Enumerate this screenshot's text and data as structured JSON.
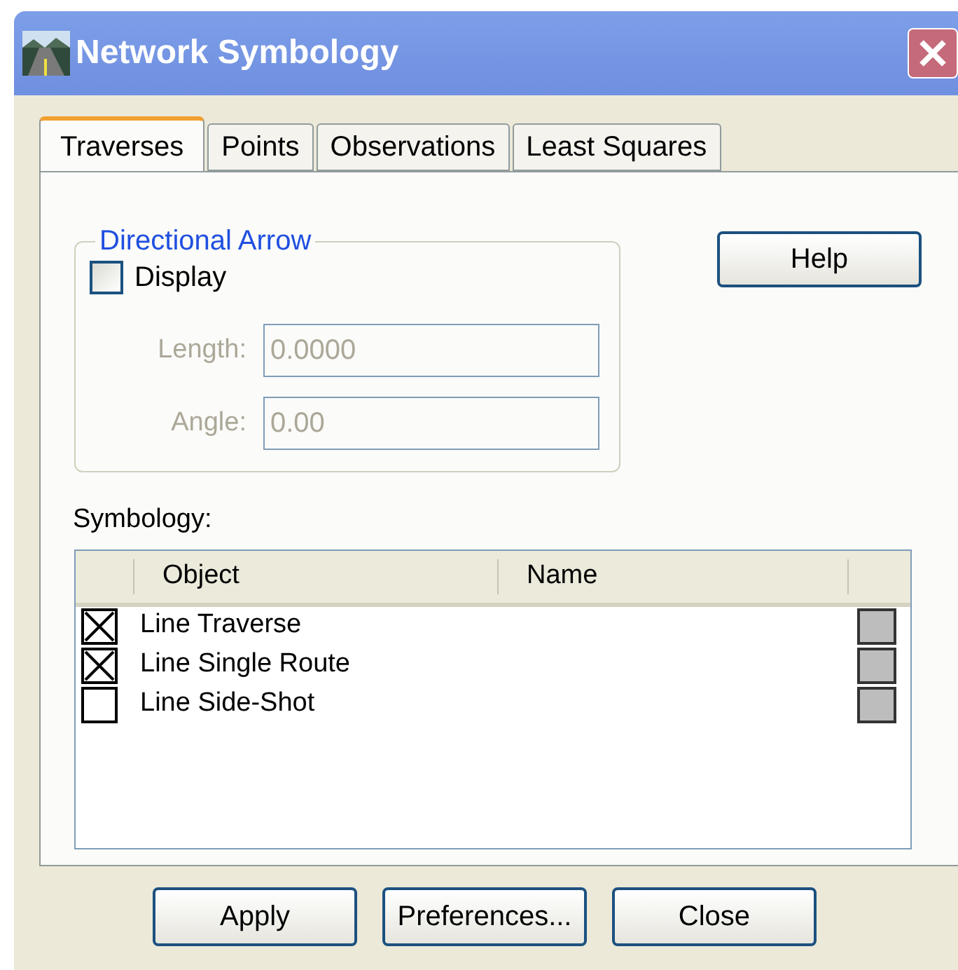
{
  "window": {
    "title": "Network Symbology"
  },
  "tabs": [
    {
      "label": "Traverses",
      "selected": true
    },
    {
      "label": "Points",
      "selected": false
    },
    {
      "label": "Observations",
      "selected": false
    },
    {
      "label": "Least Squares",
      "selected": false
    }
  ],
  "directional_arrow": {
    "legend": "Directional Arrow",
    "display": {
      "label": "Display",
      "checked": false
    },
    "fields": [
      {
        "label": "Length:",
        "value": "0.0000",
        "disabled": true
      },
      {
        "label": "Angle:",
        "value": "0.00",
        "disabled": true
      }
    ]
  },
  "help_button": "Help",
  "symbology": {
    "label": "Symbology:",
    "columns": [
      "Object",
      "Name"
    ],
    "rows": [
      {
        "object": "Line Traverse",
        "checked": true
      },
      {
        "object": "Line Single Route",
        "checked": true
      },
      {
        "object": "Line Side-Shot",
        "checked": false
      }
    ]
  },
  "buttons": [
    "Apply",
    "Preferences...",
    "Close"
  ]
}
